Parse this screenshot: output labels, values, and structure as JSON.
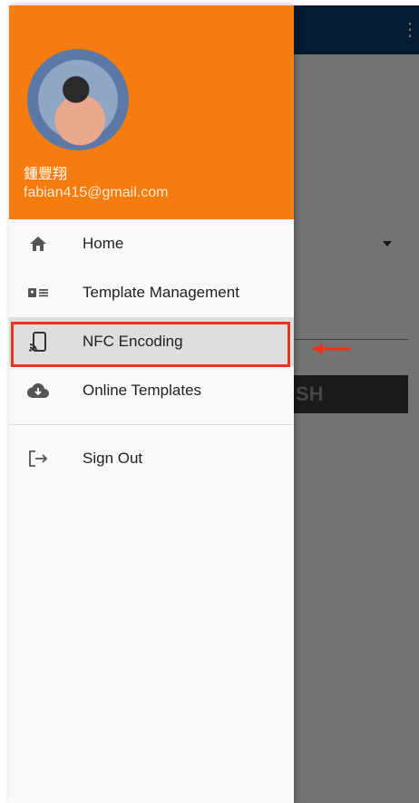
{
  "app": {
    "overflow_icon": "⋮",
    "button_text": "SH"
  },
  "drawer": {
    "user": {
      "name": "鍾豐翔",
      "email": "fabian415@gmail.com"
    },
    "menu": [
      {
        "label": "Home",
        "icon": "home-icon"
      },
      {
        "label": "Template Management",
        "icon": "template-card-icon"
      },
      {
        "label": "NFC Encoding",
        "icon": "nfc-phone-icon",
        "active": true
      },
      {
        "label": "Online Templates",
        "icon": "cloud-download-icon"
      }
    ],
    "footer_menu": [
      {
        "label": "Sign Out",
        "icon": "sign-out-icon"
      }
    ]
  },
  "colors": {
    "header_orange": "#f57c0f",
    "app_bar": "#0b3d6e",
    "highlight": "#e8341c"
  }
}
